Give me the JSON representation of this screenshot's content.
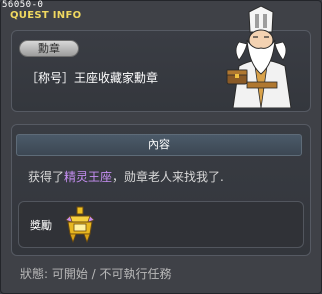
{
  "window": {
    "quest_id": "56050-0",
    "title": "QUEST INFO"
  },
  "medal": {
    "tag_label": "勳章",
    "title_text": "［称号］王座收藏家勳章"
  },
  "content": {
    "section_label": "內容",
    "line_prefix": "获得了",
    "line_highlight": "精灵王座",
    "line_suffix": "，勋章老人来找我了."
  },
  "reward": {
    "label": "獎勵",
    "icon": "golden-throne-icon"
  },
  "status": {
    "text": "狀態:  可開始  /  不可執行任務"
  },
  "colors": {
    "title_yellow": "#f0d860",
    "highlight_purple": "#c58ef2",
    "section_bar": "#4b5a69"
  }
}
